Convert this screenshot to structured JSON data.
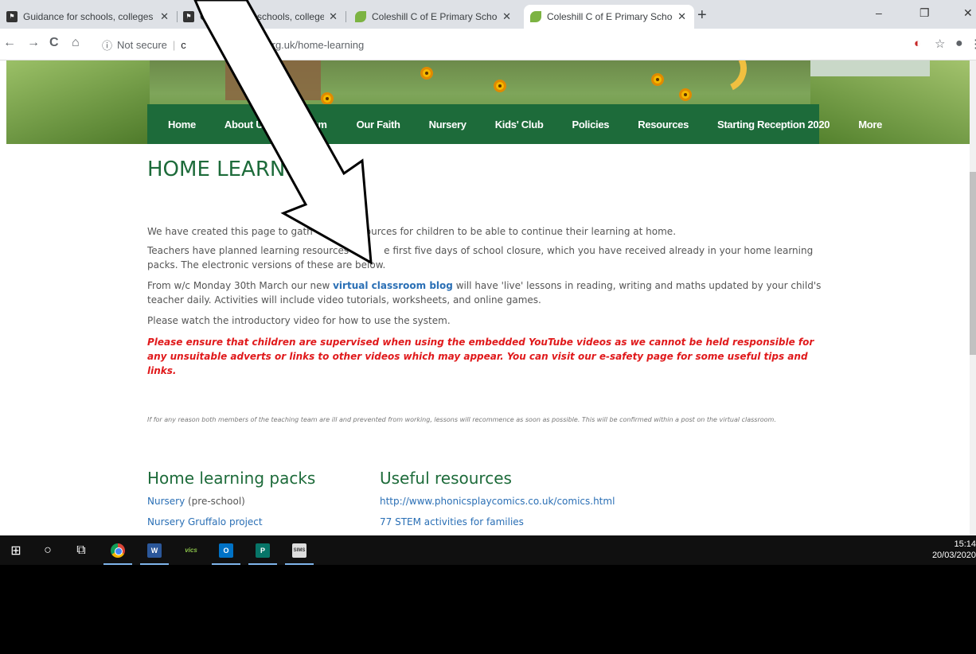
{
  "browser": {
    "tabs": [
      {
        "title": "Guidance for schools, colleges an",
        "icon": "gov-icon",
        "active": false
      },
      {
        "title": "Guidance for schools, colleges an",
        "icon": "gov-icon",
        "active": false
      },
      {
        "title": "Coleshill C of E Primary School - ",
        "icon": "leaf-icon",
        "active": false
      },
      {
        "title": "Coleshill C of E Primary School - ",
        "icon": "leaf-icon",
        "active": true
      }
    ],
    "new_tab": "+",
    "window_controls": {
      "minimize": "–",
      "restore": "❐",
      "close": "✕"
    },
    "nav": {
      "back": "←",
      "forward": "→",
      "reload": "C",
      "home": "⌂"
    },
    "address": {
      "security_label": "Not secure",
      "url_host": "coleshill.warwickshire.sch.uk",
      "url_visible": ".org.uk/home-learning",
      "url_host_visible": "c"
    }
  },
  "site": {
    "nav_items": [
      "Home",
      "About Us",
      "Curriculum",
      "Our Faith",
      "Nursery",
      "Kids' Club",
      "Policies",
      "Resources",
      "Starting Reception 2020",
      "More"
    ],
    "nav_visible": [
      "Home",
      "About U",
      "lum",
      "Our Faith",
      "Nursery",
      "Kids' Club",
      "Policies",
      "Resources",
      "Starting Reception 2020",
      "More"
    ],
    "page_title": "HOME LEARN",
    "paragraphs": {
      "p1_before": "We have created this page to gath",
      "p1_after": "ources for children to be able to continue their learning at home.",
      "p2_before": "Teachers have planned learning resources",
      "p2_after": "e first five days of school closure, which you have received already in your home learning packs. The electronic versions of these are below.",
      "p3_before": "From w/c Monday 30th March our new ",
      "p3_link": "virtual classroom blog",
      "p3_after": " will have 'live' lessons in reading, writing and maths updated by your child's teacher daily. Activities will include video tutorials, worksheets, and online games.",
      "p4": "Please watch the introductory video for how to use the system."
    },
    "warning": "Please ensure that children are supervised when using the embedded YouTube videos as we cannot be held responsible for any unsuitable adverts or links to other videos which may appear. You can visit our e-safety page for some useful tips and links.",
    "fine_print": "If for any reason both members of the teaching team are ill and prevented from working, lessons will recommence as soon as possible. This will be confirmed within a post on the virtual classroom.",
    "packs": {
      "heading": "Home learning packs",
      "items": [
        {
          "link": "Nursery",
          "suffix": " (pre-school)"
        },
        {
          "link": "Nursery Gruffalo project",
          "suffix": ""
        }
      ]
    },
    "resources": {
      "heading": "Useful resources",
      "items": [
        "http://www.phonicsplaycomics.co.uk/comics.html",
        "77 STEM activities for families"
      ]
    }
  },
  "taskbar": {
    "start": "⊞",
    "search": "○",
    "taskview": "⧉",
    "apps": [
      {
        "name": "chrome",
        "label": ""
      },
      {
        "name": "word",
        "label": "W"
      },
      {
        "name": "vmware",
        "label": "vics"
      },
      {
        "name": "outlook",
        "label": "O"
      },
      {
        "name": "publisher",
        "label": "P"
      },
      {
        "name": "sims",
        "label": "SIMS"
      }
    ],
    "time": "15:14",
    "date": "20/03/2020"
  },
  "colors": {
    "nav_green": "#1d6b3a",
    "link_blue": "#2a6fb5",
    "warning_red": "#e0191b"
  }
}
